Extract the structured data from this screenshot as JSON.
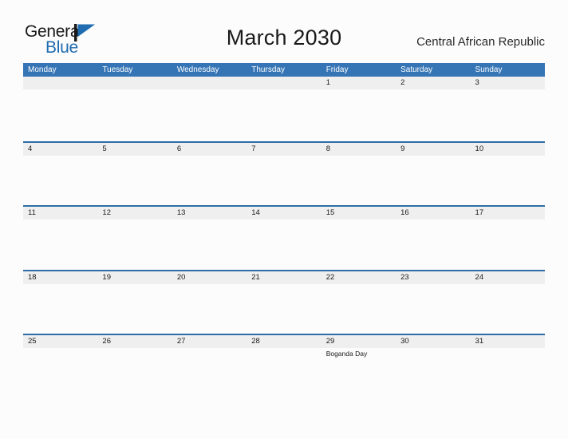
{
  "brand": {
    "name_part1": "General",
    "name_part2": "Blue",
    "flag_icon": "blue-flag-icon",
    "accent_color": "#1f6cb0"
  },
  "header": {
    "title": "March 2030",
    "country": "Central African Republic"
  },
  "theme": {
    "header_blue": "#3575b5",
    "row_border_blue": "#2e6da8",
    "band_gray": "#efefef",
    "page_bg": "#fcfcfc"
  },
  "calendar": {
    "weekdays": [
      "Monday",
      "Tuesday",
      "Wednesday",
      "Thursday",
      "Friday",
      "Saturday",
      "Sunday"
    ],
    "weeks": [
      [
        {
          "day": "",
          "event": ""
        },
        {
          "day": "",
          "event": ""
        },
        {
          "day": "",
          "event": ""
        },
        {
          "day": "",
          "event": ""
        },
        {
          "day": "1",
          "event": ""
        },
        {
          "day": "2",
          "event": ""
        },
        {
          "day": "3",
          "event": ""
        }
      ],
      [
        {
          "day": "4",
          "event": ""
        },
        {
          "day": "5",
          "event": ""
        },
        {
          "day": "6",
          "event": ""
        },
        {
          "day": "7",
          "event": ""
        },
        {
          "day": "8",
          "event": ""
        },
        {
          "day": "9",
          "event": ""
        },
        {
          "day": "10",
          "event": ""
        }
      ],
      [
        {
          "day": "11",
          "event": ""
        },
        {
          "day": "12",
          "event": ""
        },
        {
          "day": "13",
          "event": ""
        },
        {
          "day": "14",
          "event": ""
        },
        {
          "day": "15",
          "event": ""
        },
        {
          "day": "16",
          "event": ""
        },
        {
          "day": "17",
          "event": ""
        }
      ],
      [
        {
          "day": "18",
          "event": ""
        },
        {
          "day": "19",
          "event": ""
        },
        {
          "day": "20",
          "event": ""
        },
        {
          "day": "21",
          "event": ""
        },
        {
          "day": "22",
          "event": ""
        },
        {
          "day": "23",
          "event": ""
        },
        {
          "day": "24",
          "event": ""
        }
      ],
      [
        {
          "day": "25",
          "event": ""
        },
        {
          "day": "26",
          "event": ""
        },
        {
          "day": "27",
          "event": ""
        },
        {
          "day": "28",
          "event": ""
        },
        {
          "day": "29",
          "event": "Boganda Day"
        },
        {
          "day": "30",
          "event": ""
        },
        {
          "day": "31",
          "event": ""
        }
      ]
    ]
  }
}
